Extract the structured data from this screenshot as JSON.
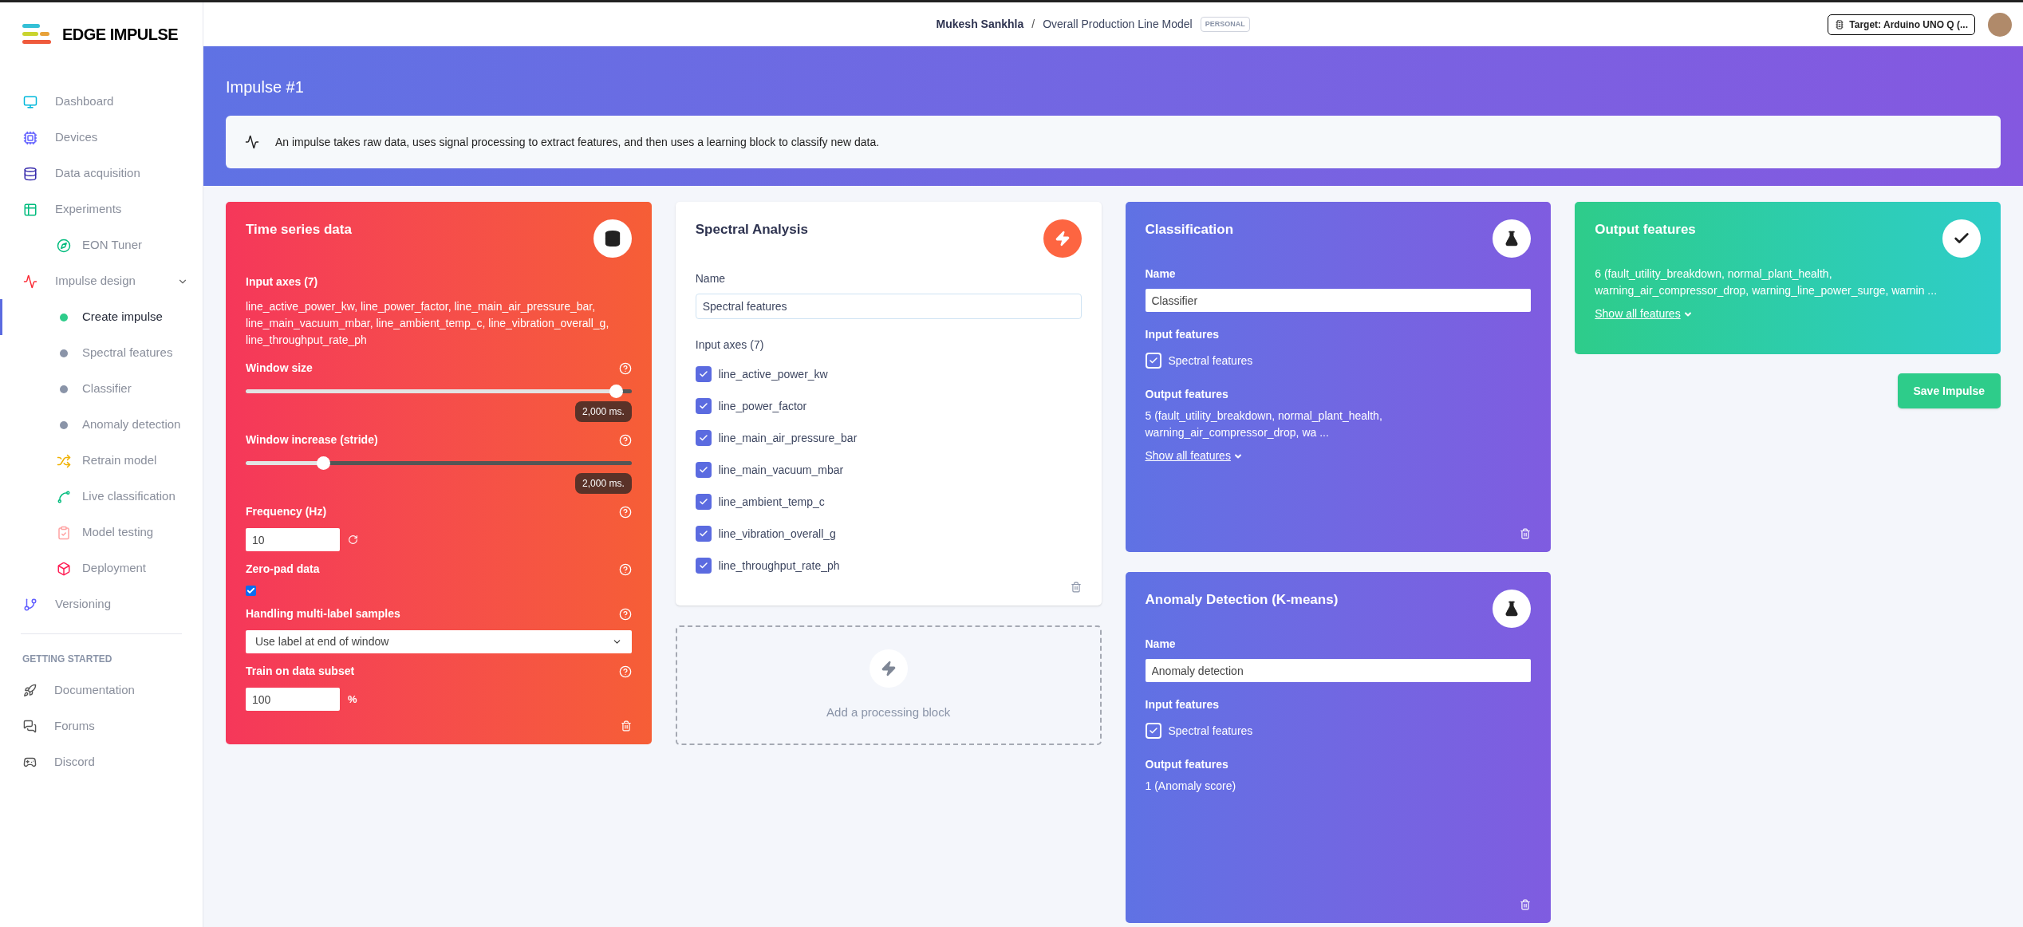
{
  "brand": {
    "name": "EDGE IMPULSE"
  },
  "sidebar": {
    "items": [
      {
        "label": "Dashboard",
        "selected": false
      },
      {
        "label": "Devices",
        "selected": false
      },
      {
        "label": "Data acquisition",
        "selected": false
      },
      {
        "label": "Experiments",
        "selected": false,
        "children": [
          {
            "label": "EON Tuner",
            "kind": "icon",
            "selected": false
          }
        ]
      },
      {
        "label": "Impulse design",
        "selected": false,
        "expanded": true,
        "children": [
          {
            "label": "Create impulse",
            "kind": "dot",
            "color": "#2ecc8a",
            "selected": true
          },
          {
            "label": "Spectral features",
            "kind": "dot",
            "color": "#8a94a8",
            "selected": false
          },
          {
            "label": "Classifier",
            "kind": "dot",
            "color": "#8a94a8",
            "selected": false
          },
          {
            "label": "Anomaly detection",
            "kind": "dot",
            "color": "#8a94a8",
            "selected": false
          },
          {
            "label": "Retrain model",
            "kind": "icon",
            "selected": false
          },
          {
            "label": "Live classification",
            "kind": "icon",
            "selected": false
          },
          {
            "label": "Model testing",
            "kind": "icon",
            "selected": false
          },
          {
            "label": "Deployment",
            "kind": "icon",
            "selected": false
          }
        ]
      },
      {
        "label": "Versioning",
        "selected": false
      }
    ],
    "section_heading": "GETTING STARTED",
    "section_items": [
      {
        "label": "Documentation"
      },
      {
        "label": "Forums"
      },
      {
        "label": "Discord"
      }
    ]
  },
  "header": {
    "user": "Mukesh Sankhla",
    "separator": "/",
    "project": "Overall Production Line Model",
    "badge": "PERSONAL",
    "target": "Target: Arduino UNO Q (..."
  },
  "banner": {
    "title": "Impulse #1",
    "info": "An impulse takes raw data, uses signal processing to extract features, and then uses a learning block to classify new data."
  },
  "time_series": {
    "title": "Time series data",
    "fields": [
      {
        "kind": "text",
        "label": "Input axes (7)",
        "text": "line_active_power_kw, line_power_factor, line_main_air_pressure_bar, line_main_vacuum_mbar, line_ambient_temp_c, line_vibration_overall_g, line_throughput_rate_ph"
      },
      {
        "kind": "slider",
        "label": "Window size",
        "level": 0.96,
        "reading": "2,000 ms."
      },
      {
        "kind": "slider",
        "label": "Window increase (stride)",
        "level": 0.2,
        "reading": "2,000 ms."
      },
      {
        "kind": "number",
        "label": "Frequency (Hz)",
        "value": "10"
      },
      {
        "kind": "checkbox",
        "label": "Zero-pad data",
        "checked": true
      },
      {
        "kind": "select",
        "label": "Handling multi-label samples",
        "value": "Use label at end of window"
      },
      {
        "kind": "number",
        "label": "Train on data subset",
        "value": "100",
        "unit": "%"
      }
    ]
  },
  "spectral": {
    "title": "Spectral Analysis",
    "name_label": "Name",
    "name_value": "Spectral features",
    "axes_label": "Input axes (7)",
    "axes": [
      {
        "label": "line_active_power_kw",
        "checked": true
      },
      {
        "label": "line_power_factor",
        "checked": true
      },
      {
        "label": "line_main_air_pressure_bar",
        "checked": true
      },
      {
        "label": "line_main_vacuum_mbar",
        "checked": true
      },
      {
        "label": "line_ambient_temp_c",
        "checked": true
      },
      {
        "label": "line_vibration_overall_g",
        "checked": true
      },
      {
        "label": "line_throughput_rate_ph",
        "checked": true
      }
    ]
  },
  "add_block": {
    "label": "Add a processing block"
  },
  "learning_blocks": [
    {
      "title": "Classification",
      "name_label": "Name",
      "name_value": "Classifier",
      "input_label": "Input features",
      "inputs": [
        {
          "label": "Spectral features",
          "checked": true
        }
      ],
      "output_label": "Output features",
      "output_text": "5 (fault_utility_breakdown, normal_plant_health, warning_air_compressor_drop, wa ...",
      "show_all": "Show all features"
    },
    {
      "title": "Anomaly Detection (K-means)",
      "name_label": "Name",
      "name_value": "Anomaly detection",
      "input_label": "Input features",
      "inputs": [
        {
          "label": "Spectral features",
          "checked": true
        }
      ],
      "output_label": "Output features",
      "output_text": "1 (Anomaly score)"
    }
  ],
  "output": {
    "title": "Output features",
    "text": "6 (fault_utility_breakdown, normal_plant_health, warning_air_compressor_drop, warning_line_power_surge, warnin ...",
    "show_all": "Show all features"
  },
  "save_button": "Save Impulse"
}
